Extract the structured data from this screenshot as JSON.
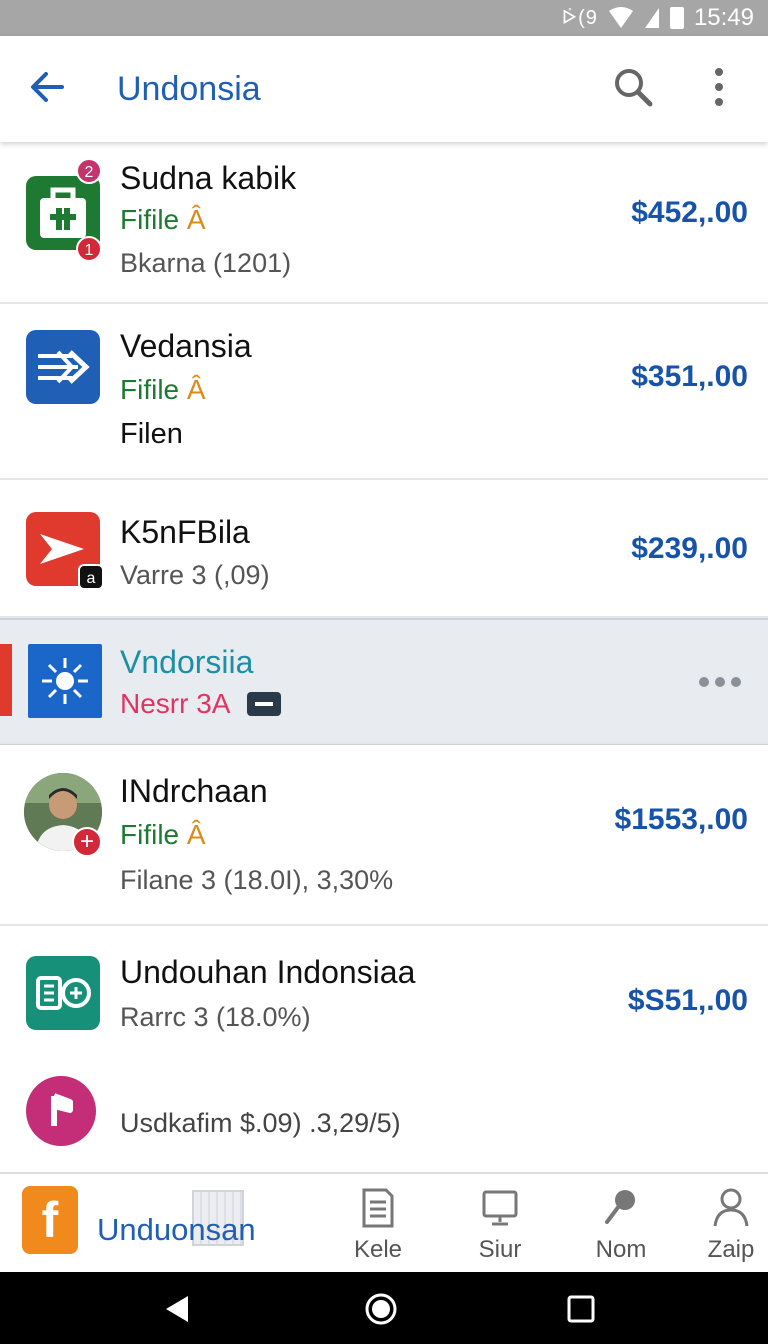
{
  "status_bar": {
    "signal_text": "ᢰ(9",
    "time": "15:49"
  },
  "app_bar": {
    "title": "Undonsia"
  },
  "items": [
    {
      "name": "Sudna kabik",
      "sub": "Fifile",
      "sub_mark": "Â",
      "meta": "Bkarna (1201)",
      "price": "$452,.00",
      "badge_top": "2",
      "badge_bottom": "1",
      "icon": "shopping-bag-icon",
      "color": "#1e7a32"
    },
    {
      "name": "Vedansia",
      "sub": "Fifile",
      "sub_mark": "Â",
      "meta": "Filen",
      "price": "$351,.00",
      "icon": "arrows-icon",
      "color": "#1f5fb5"
    },
    {
      "name": "K5nFBila",
      "meta": "Varre 3 (,09)",
      "price": "$239,.00",
      "icon": "play-arrow-icon",
      "color": "#e03a2e",
      "badge_corner": "a"
    },
    {
      "name": "Vndorsiia",
      "sub": "Nesrr 3A",
      "icon": "spark-icon",
      "color": "#1b66c9",
      "name_color": "#1a8fa6",
      "sub_color": "#e03462"
    },
    {
      "name": "INdrchaan",
      "sub": "Fifile",
      "sub_mark": "Â",
      "meta": "Filane 3 (18.0I), 3,30%",
      "price": "$1553,.00",
      "icon": "avatar"
    },
    {
      "name": "Undouhan Indonsiaa",
      "meta": "Rarrc 3 (18.0%)",
      "price": "$S51,.00",
      "icon": "data-icon",
      "color": "#17907a"
    },
    {
      "meta": "Usdkafim $.09) .3,29/5)",
      "icon": "music-icon",
      "color": "#c42e78"
    }
  ],
  "bottom_nav": {
    "brand_label": "Unduonsan",
    "items": [
      {
        "label": "Kele",
        "icon": "document-icon"
      },
      {
        "label": "Siur",
        "icon": "monitor-icon"
      },
      {
        "label": "Nom",
        "icon": "pin-icon"
      },
      {
        "label": "Zaip",
        "icon": "person-icon"
      }
    ]
  }
}
